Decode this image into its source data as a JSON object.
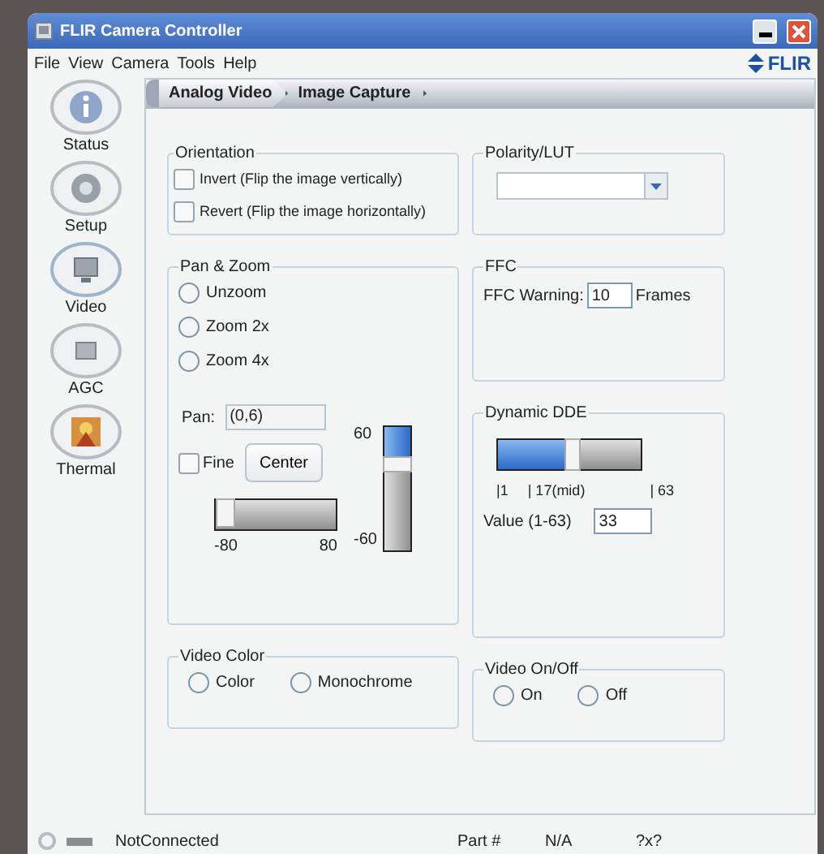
{
  "window": {
    "title": "FLIR Camera Controller",
    "logo": "FLIR"
  },
  "menu": [
    "File",
    "View",
    "Camera",
    "Tools",
    "Help"
  ],
  "sidebar": {
    "items": [
      {
        "label": "Status",
        "kind": "info",
        "selected": false
      },
      {
        "label": "Setup",
        "kind": "gear",
        "selected": false
      },
      {
        "label": "Video",
        "kind": "monitor",
        "selected": true
      },
      {
        "label": "AGC",
        "kind": "square",
        "selected": false
      },
      {
        "label": "Thermal",
        "kind": "thermal",
        "selected": false
      }
    ]
  },
  "tabs": [
    {
      "label": "Analog Video",
      "selected": true
    },
    {
      "label": "Image Capture",
      "selected": false
    }
  ],
  "orientation": {
    "title": "Orientation",
    "options": [
      {
        "label": "Invert (Flip the image vertically)",
        "checked": false
      },
      {
        "label": "Revert (Flip the image horizontally)",
        "checked": false
      }
    ]
  },
  "pan_zoom": {
    "title": "Pan & Zoom",
    "zoom_options": [
      {
        "label": "Unzoom",
        "selected": false
      },
      {
        "label": "Zoom 2x",
        "selected": false
      },
      {
        "label": "Zoom 4x",
        "selected": false
      }
    ],
    "pan_label": "Pan:",
    "pan_value": "(0,6)",
    "fine": {
      "label": "Fine",
      "checked": false
    },
    "center_button": "Center",
    "vertical_slider": {
      "max_label": "60",
      "min_label": "-60",
      "level": 0.72
    },
    "horizontal_slider": {
      "min_label": "-80",
      "max_label": "80",
      "level": 0
    }
  },
  "video_color": {
    "title": "Video Color",
    "options": [
      {
        "label": "Color",
        "selected": false
      },
      {
        "label": "Monochrome",
        "selected": false
      }
    ]
  },
  "polarity": {
    "title": "Polarity/LUT"
  },
  "ffc": {
    "title": "FFC",
    "label": "FFC Warning:",
    "value": "10",
    "unit": "Frames"
  },
  "dynamic_dde": {
    "title": "Dynamic DDE",
    "level": 0.52,
    "ticks": [
      "|1",
      "| 17(mid)",
      "| 63"
    ],
    "value_label": "Value (1-63)",
    "value": "33"
  },
  "video_onoff": {
    "title": "Video On/Off",
    "options": [
      {
        "label": "On",
        "selected": false
      },
      {
        "label": "Off",
        "selected": false
      }
    ]
  },
  "status_bar": {
    "connection": "NotConnected",
    "part_label": "Part #",
    "part_value": "N/A",
    "size": "?x?"
  }
}
